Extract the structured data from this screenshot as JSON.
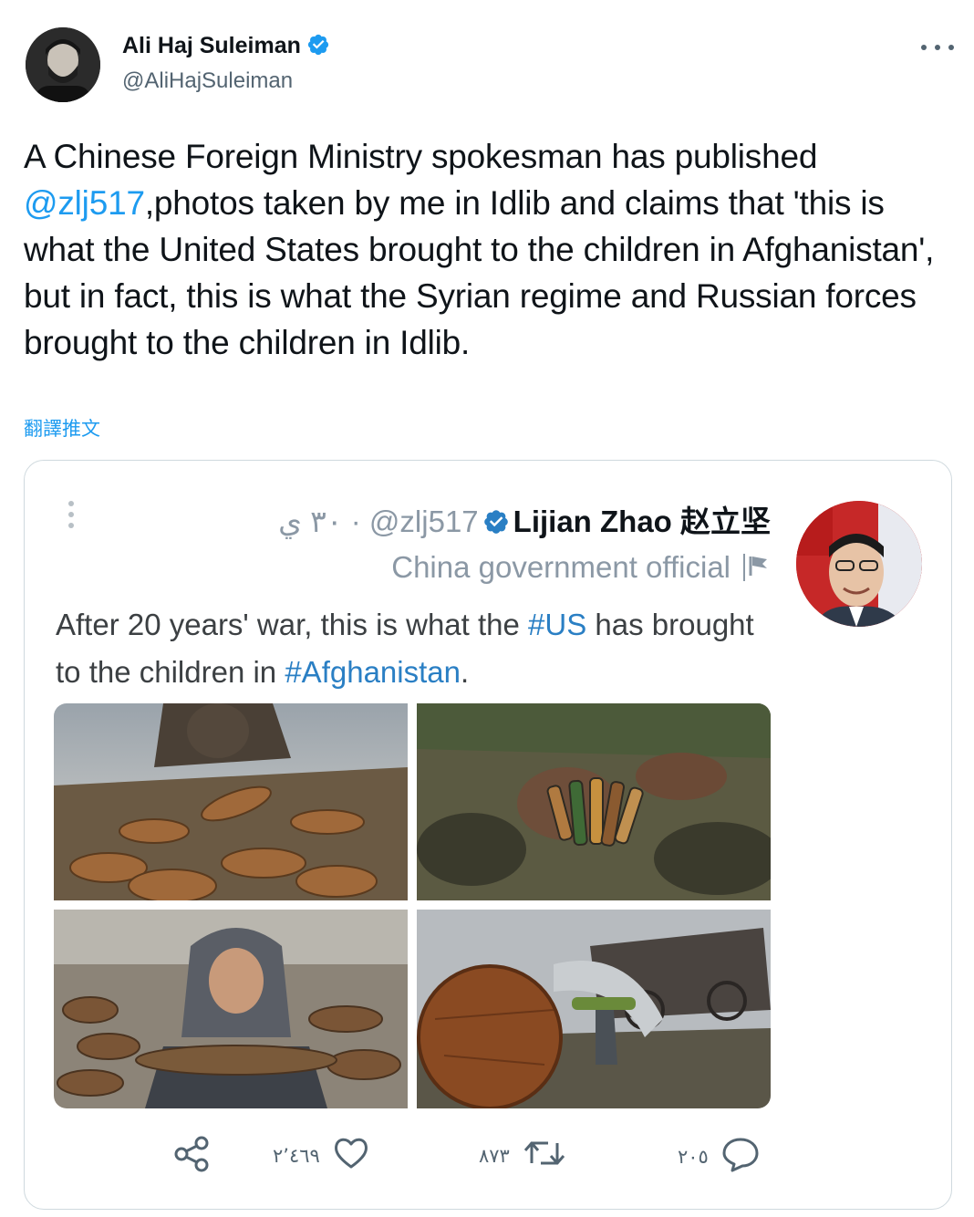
{
  "author": {
    "name": "Ali Haj Suleiman",
    "handle": "@AliHajSuleiman",
    "verified": true
  },
  "tweet": {
    "text_before": "A Chinese Foreign Ministry spokesman has published ",
    "mention": "@zlj517",
    "text_after": ",photos taken by me in Idlib and claims that 'this is what the United States brought to the children in Afghanistan', but in fact, this is what the Syrian regime and Russian forces brought to the children in Idlib."
  },
  "translate_label": "翻譯推文",
  "quoted": {
    "date": "٣٠ ي",
    "separator": "·",
    "handle": "@zlj517",
    "name": "Lijian Zhao 赵立坚",
    "label": "China government official",
    "text_part1": "After 20 years' war, this is what the ",
    "hashtag1": "#US",
    "text_part2": " has brought to the children in ",
    "hashtag2": "#Afghanistan",
    "text_part3": ".",
    "actions": {
      "reply_count": "٢٠٥",
      "retweet_count": "٨٧٣",
      "like_count": "٢٬٤٦٩"
    }
  },
  "icons": {
    "more": "more-horizontal-icon",
    "verified": "verified-badge-icon",
    "vertical_more": "more-vertical-icon",
    "flag": "flag-icon",
    "share": "share-icon",
    "like": "heart-icon",
    "retweet": "retweet-icon",
    "reply": "reply-icon"
  },
  "colors": {
    "link": "#1d9bf0",
    "text": "#0f1419",
    "secondary": "#536471",
    "border": "#cfd9de"
  }
}
